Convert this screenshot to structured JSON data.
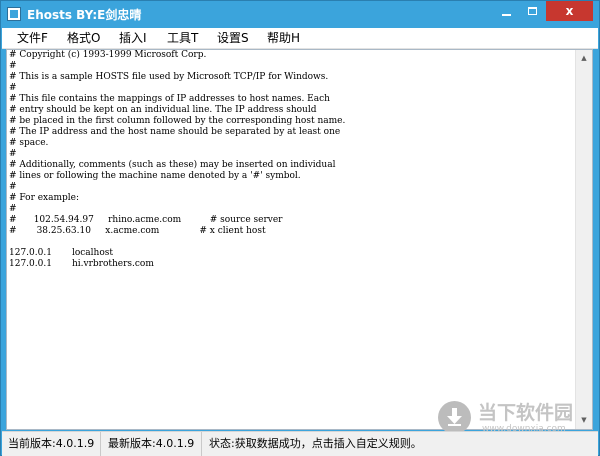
{
  "window": {
    "title": "Ehosts BY:E剑忠晴",
    "minimize_icon": "minimize-icon",
    "maximize_icon": "maximize-icon",
    "close_label": "x",
    "accent_color": "#3ba4dc",
    "close_color": "#c7372f"
  },
  "menu": {
    "items": [
      {
        "label": "文件F"
      },
      {
        "label": "格式O"
      },
      {
        "label": "插入I"
      },
      {
        "label": "工具T"
      },
      {
        "label": "设置S"
      },
      {
        "label": "帮助H"
      }
    ]
  },
  "editor": {
    "content": "# Copyright (c) 1993-1999 Microsoft Corp.\n#\n# This is a sample HOSTS file used by Microsoft TCP/IP for Windows.\n#\n# This file contains the mappings of IP addresses to host names. Each\n# entry should be kept on an individual line. The IP address should\n# be placed in the first column followed by the corresponding host name.\n# The IP address and the host name should be separated by at least one\n# space.\n#\n# Additionally, comments (such as these) may be inserted on individual\n# lines or following the machine name denoted by a '#' symbol.\n#\n# For example:\n#\n#      102.54.94.97     rhino.acme.com          # source server\n#       38.25.63.10     x.acme.com              # x client host\n\n127.0.0.1       localhost\n127.0.0.1       hi.vrbrothers.com"
  },
  "watermark": {
    "text": "当下软件园",
    "url": "www.downxia.com"
  },
  "status": {
    "current_version": "当前版本:4.0.1.9",
    "latest_version": "最新版本:4.0.1.9",
    "message": "状态:获取数据成功，点击插入自定义规则。"
  }
}
